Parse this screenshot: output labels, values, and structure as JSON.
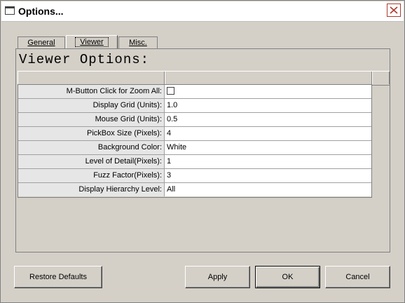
{
  "window": {
    "title": "Options..."
  },
  "tabs": [
    {
      "label": "General"
    },
    {
      "label": "Viewer"
    },
    {
      "label": "Misc."
    }
  ],
  "panel": {
    "title": "Viewer Options:"
  },
  "properties": [
    {
      "label": "M-Button Click for Zoom All:",
      "value": "",
      "checked": false
    },
    {
      "label": "Display Grid (Units):",
      "value": "1.0"
    },
    {
      "label": "Mouse Grid (Units):",
      "value": "0.5"
    },
    {
      "label": "PickBox Size (Pixels):",
      "value": "4"
    },
    {
      "label": "Background Color:",
      "value": "White"
    },
    {
      "label": "Level of Detail(Pixels):",
      "value": "1"
    },
    {
      "label": "Fuzz Factor(Pixels):",
      "value": "3"
    },
    {
      "label": "Display Hierarchy Level:",
      "value": "All"
    }
  ],
  "buttons": {
    "restore": "Restore Defaults",
    "apply": "Apply",
    "ok": "OK",
    "cancel": "Cancel"
  },
  "colors": {
    "close_button": "#b03a2e",
    "dialog_bg": "#d4d0c8"
  }
}
